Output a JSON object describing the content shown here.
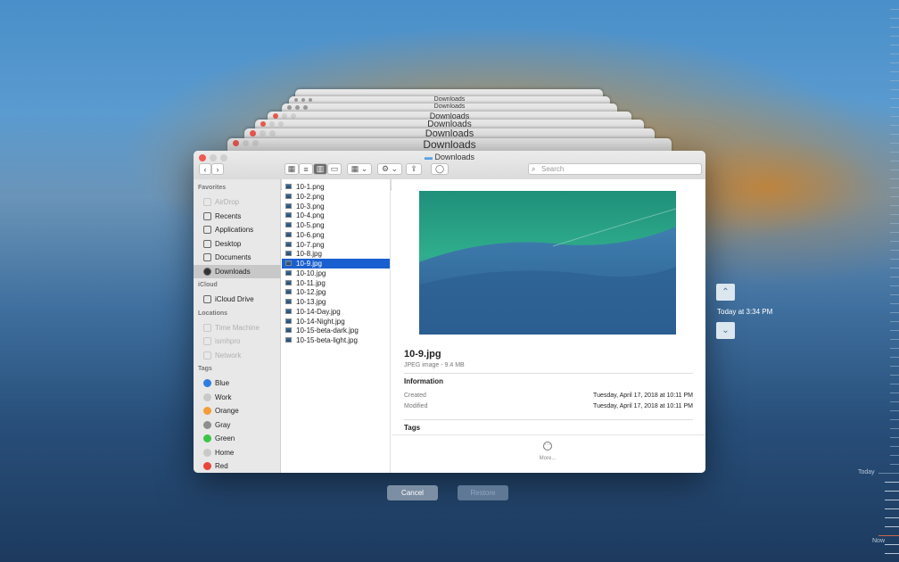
{
  "stack_titles": [
    "Downloads",
    "Downloads",
    "Downloads",
    "Downloads",
    "Downloads",
    "Downloads"
  ],
  "window": {
    "title": "Downloads",
    "search_placeholder": "Search"
  },
  "sidebar": {
    "favorites_header": "Favorites",
    "favorites": [
      {
        "label": "AirDrop",
        "icon": "airdrop-icon",
        "dim": true
      },
      {
        "label": "Recents",
        "icon": "recents-icon"
      },
      {
        "label": "Applications",
        "icon": "applications-icon"
      },
      {
        "label": "Desktop",
        "icon": "desktop-icon"
      },
      {
        "label": "Documents",
        "icon": "documents-icon"
      },
      {
        "label": "Downloads",
        "icon": "downloads-icon",
        "selected": true
      }
    ],
    "icloud_header": "iCloud",
    "icloud": [
      {
        "label": "iCloud Drive",
        "icon": "cloud-icon"
      }
    ],
    "locations_header": "Locations",
    "locations": [
      {
        "label": "Time Machine",
        "icon": "disk-icon",
        "dim": true
      },
      {
        "label": "ismhpro",
        "icon": "computer-icon",
        "dim": true
      },
      {
        "label": "Network",
        "icon": "network-icon",
        "dim": true
      }
    ],
    "tags_header": "Tags",
    "tags": [
      {
        "label": "Blue",
        "color": "#2f7de1"
      },
      {
        "label": "Work",
        "color": "#c8c8c8"
      },
      {
        "label": "Orange",
        "color": "#f39c38"
      },
      {
        "label": "Gray",
        "color": "#8e8e8e"
      },
      {
        "label": "Green",
        "color": "#3cc44a"
      },
      {
        "label": "Home",
        "color": "#c8c8c8"
      },
      {
        "label": "Red",
        "color": "#e8453c"
      }
    ]
  },
  "files": [
    "10-1.png",
    "10-2.png",
    "10-3.png",
    "10-4.png",
    "10-5.png",
    "10-6.png",
    "10-7.png",
    "10-8.jpg",
    "10-9.jpg",
    "10-10.jpg",
    "10-11.jpg",
    "10-12.jpg",
    "10-13.jpg",
    "10-14-Day.jpg",
    "10-14-Night.jpg",
    "10-15-beta-dark.jpg",
    "10-15-beta-light.jpg"
  ],
  "selected_file": "10-9.jpg",
  "preview": {
    "name": "10-9.jpg",
    "kind": "JPEG image - 9.4 MB",
    "info_header": "Information",
    "created_label": "Created",
    "created_value": "Tuesday, April 17, 2018 at 10:11 PM",
    "modified_label": "Modified",
    "modified_value": "Tuesday, April 17, 2018 at 10:11 PM",
    "tags_header": "Tags",
    "more_label": "More..."
  },
  "buttons": {
    "cancel": "Cancel",
    "restore": "Restore"
  },
  "timeline": {
    "current": "Today at 3:34 PM",
    "today_label": "Today",
    "now_label": "Now"
  }
}
